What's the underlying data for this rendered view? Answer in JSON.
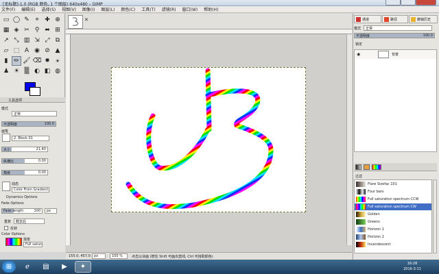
{
  "window": {
    "title": "[无标题]-1.0 (RGB 颜色, 1 个图层) 640x480 – GIMP"
  },
  "menu": [
    "文件(F)",
    "编辑(E)",
    "选择(S)",
    "视图(V)",
    "图像(I)",
    "图层(L)",
    "颜色(C)",
    "工具(T)",
    "滤镜(R)",
    "窗口(W)",
    "帮助(H)"
  ],
  "tools": [
    "▭",
    "◯",
    "✎",
    "⌖",
    "✚",
    "⊕",
    "▦",
    "◈",
    "✂",
    "⚲",
    "⬌",
    "⊞",
    "↗",
    "⤡",
    "▥",
    "⇲",
    "⤢",
    "⧉",
    "▱",
    "⬚",
    "A",
    "◉",
    "⊘",
    "▲",
    "▮",
    "✏",
    "🖌",
    "⌫",
    "✹",
    "⚹",
    "♟",
    "☀",
    "▒",
    "◐",
    "◧",
    "◍"
  ],
  "tool_options": {
    "title": "工具选项",
    "mode_label": "模式",
    "mode_value": "正常",
    "opacity_label": "不透明度",
    "opacity_value": "100.0",
    "brush_label": "画笔",
    "brush_value": "2. Block 01",
    "size_label": "大小",
    "size_value": "21.40",
    "aspect_label": "纵横比",
    "aspect_value": "0.00",
    "angle_label": "角度",
    "angle_value": "0.00",
    "dynamics_label": "动态",
    "dynamics_value": "Color From Gradient",
    "dynamics_options": "Dynamics Options",
    "fade_options": "Fade Options",
    "fade_length_label": "Fade length",
    "fade_length_value": "100",
    "fade_unit": "px",
    "repeat_label": "重复",
    "repeat_value": "截去后",
    "reverse_label": "反转",
    "color_options": "Color Options",
    "gradient_label": "渐变",
    "gradient_value": "Full saturat"
  },
  "canvas": {
    "thumb_mark": "✕"
  },
  "status": {
    "coords": "155.0, 457.0",
    "unit": "px",
    "zoom": "100 %",
    "message": "点击以涂画 (按住 Shift 可画出直线, Ctrl 可拾取颜色)"
  },
  "dock": {
    "btn1": "通道",
    "btn2": "路径",
    "btn3": "撤销历史",
    "mode_label": "模式",
    "mode_value": "正常",
    "opacity_label": "不透明度",
    "opacity_value": "100.0",
    "lock_label": "锁定",
    "layer_name": "背景",
    "filter_label": "过滤"
  },
  "gradients": [
    {
      "name": "Flare Sizefac 101",
      "colors": [
        "#3b2f2f",
        "#e8e1d6"
      ]
    },
    {
      "name": "Four bars",
      "colors": [
        "#eeeeee",
        "#111111",
        "#eeeeee",
        "#111111"
      ]
    },
    {
      "name": "Full saturation spectrum CCW",
      "colors": [
        "#ff0000",
        "#ffff00",
        "#00ff00",
        "#00ffff",
        "#0000ff",
        "#ff00ff",
        "#ff0000"
      ]
    },
    {
      "name": "Full saturation spectrum CW",
      "colors": [
        "#ff0000",
        "#ff00ff",
        "#0000ff",
        "#00ffff",
        "#00ff00",
        "#ffff00",
        "#ff0000"
      ]
    },
    {
      "name": "Golden",
      "colors": [
        "#2a1a05",
        "#c9a23a",
        "#fff2b0"
      ]
    },
    {
      "name": "Greens",
      "colors": [
        "#0f3a0f",
        "#7ad05a"
      ]
    },
    {
      "name": "Horizon 1",
      "colors": [
        "#ffffff",
        "#3b73c6",
        "#d8b070"
      ]
    },
    {
      "name": "Horizon 2",
      "colors": [
        "#204070",
        "#b0c8f0",
        "#805028"
      ]
    },
    {
      "name": "Incandescent",
      "colors": [
        "#000000",
        "#c03010",
        "#ffe060"
      ]
    }
  ],
  "selected_gradient_index": 3,
  "taskbar": {
    "time": "16:28",
    "date": "2016-3-11"
  },
  "colors": {
    "foreground": "#0000ee",
    "background": "#ffffff"
  }
}
